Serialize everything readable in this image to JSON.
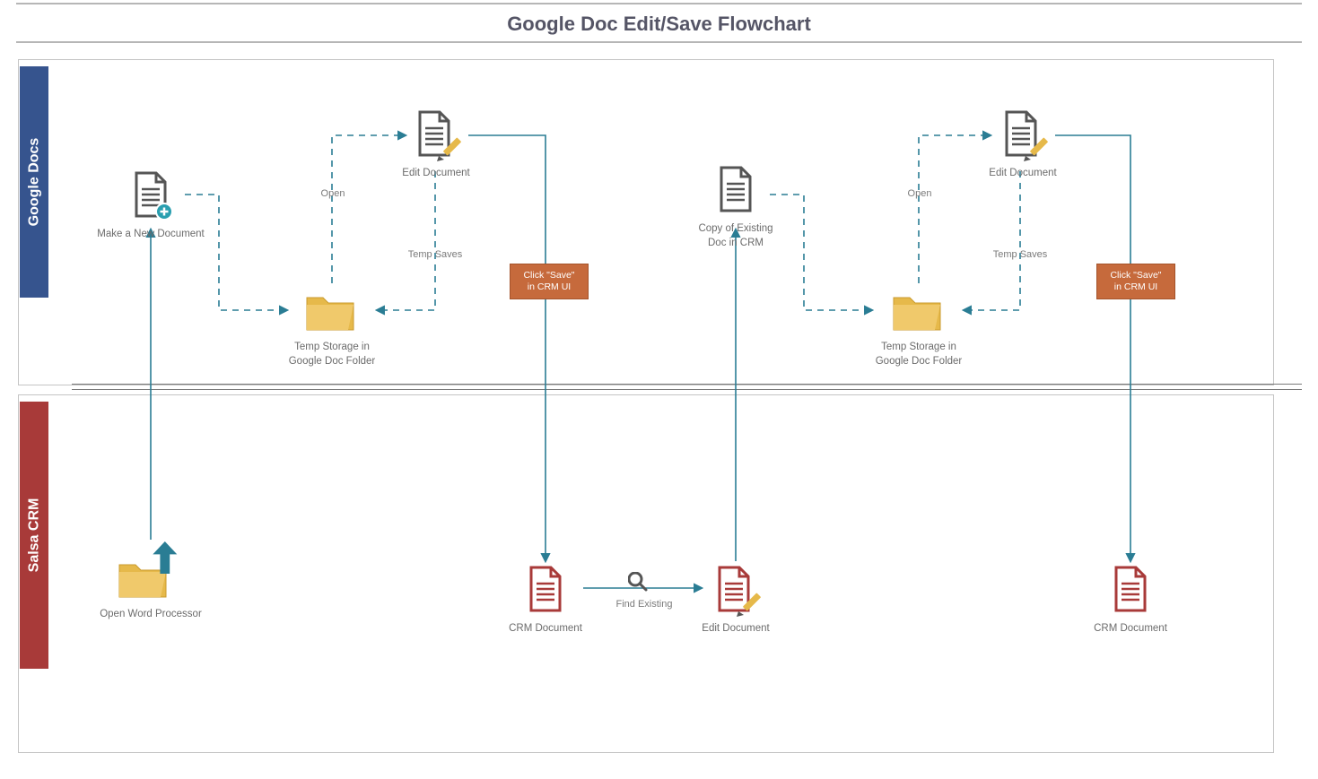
{
  "title": "Google Doc Edit/Save Flowchart",
  "lanes": {
    "top": {
      "name": "Google Docs",
      "color": "#36548e"
    },
    "bottom": {
      "name": "Salsa CRM",
      "color": "#a83a39"
    }
  },
  "nodes": {
    "newDoc": {
      "label": "Make a New Document"
    },
    "editDoc1": {
      "label": "Edit Document"
    },
    "tempStorage1": {
      "label": "Temp Storage in\nGoogle Doc Folder"
    },
    "copyExisting": {
      "label": "Copy of Existing\nDoc in CRM"
    },
    "editDoc2": {
      "label": "Edit Document"
    },
    "tempStorage2": {
      "label": "Temp Storage in\nGoogle Doc Folder"
    },
    "openWP": {
      "label": "Open Word Processor"
    },
    "crmDoc1": {
      "label": "CRM Document"
    },
    "editCrmDoc": {
      "label": "Edit Document"
    },
    "crmDoc2": {
      "label": "CRM Document"
    }
  },
  "edgeLabels": {
    "open": "Open",
    "tempSaves": "Temp Saves",
    "findExisting": "Find Existing",
    "saveBadge": "Click \"Save\"\nin CRM UI"
  },
  "chart_data": {
    "type": "flowchart",
    "title": "Google Doc Edit/Save Flowchart",
    "swimlanes": [
      {
        "id": "gdocs",
        "name": "Google Docs"
      },
      {
        "id": "crm",
        "name": "Salsa CRM"
      }
    ],
    "nodes": [
      {
        "id": "openWP",
        "lane": "crm",
        "label": "Open Word Processor",
        "kind": "action"
      },
      {
        "id": "newDoc",
        "lane": "gdocs",
        "label": "Make a New Document",
        "kind": "document-new"
      },
      {
        "id": "tempStorage1",
        "lane": "gdocs",
        "label": "Temp Storage in Google Doc Folder",
        "kind": "folder"
      },
      {
        "id": "editDoc1",
        "lane": "gdocs",
        "label": "Edit Document",
        "kind": "document-edit"
      },
      {
        "id": "crmDoc1",
        "lane": "crm",
        "label": "CRM Document",
        "kind": "document"
      },
      {
        "id": "editCrmDoc",
        "lane": "crm",
        "label": "Edit Document",
        "kind": "document-edit"
      },
      {
        "id": "copyExisting",
        "lane": "gdocs",
        "label": "Copy of Existing Doc in CRM",
        "kind": "document"
      },
      {
        "id": "tempStorage2",
        "lane": "gdocs",
        "label": "Temp Storage in Google Doc Folder",
        "kind": "folder"
      },
      {
        "id": "editDoc2",
        "lane": "gdocs",
        "label": "Edit Document",
        "kind": "document-edit"
      },
      {
        "id": "crmDoc2",
        "lane": "crm",
        "label": "CRM Document",
        "kind": "document"
      }
    ],
    "edges": [
      {
        "from": "openWP",
        "to": "newDoc",
        "style": "solid"
      },
      {
        "from": "newDoc",
        "to": "tempStorage1",
        "style": "dashed"
      },
      {
        "from": "tempStorage1",
        "to": "editDoc1",
        "style": "dashed",
        "label": "Open"
      },
      {
        "from": "editDoc1",
        "to": "tempStorage1",
        "style": "dashed",
        "label": "Temp Saves"
      },
      {
        "from": "editDoc1",
        "to": "crmDoc1",
        "style": "solid",
        "label": "Click \"Save\" in CRM UI"
      },
      {
        "from": "crmDoc1",
        "to": "editCrmDoc",
        "style": "solid",
        "label": "Find Existing"
      },
      {
        "from": "editCrmDoc",
        "to": "copyExisting",
        "style": "solid"
      },
      {
        "from": "copyExisting",
        "to": "tempStorage2",
        "style": "dashed"
      },
      {
        "from": "tempStorage2",
        "to": "editDoc2",
        "style": "dashed",
        "label": "Open"
      },
      {
        "from": "editDoc2",
        "to": "tempStorage2",
        "style": "dashed",
        "label": "Temp Saves"
      },
      {
        "from": "editDoc2",
        "to": "crmDoc2",
        "style": "solid",
        "label": "Click \"Save\" in CRM UI"
      }
    ]
  }
}
